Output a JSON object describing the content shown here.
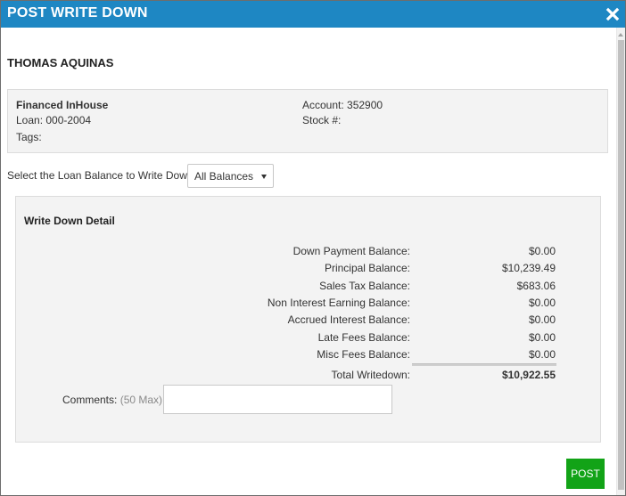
{
  "dialog": {
    "title": "POST WRITE DOWN",
    "close_icon": "close-x-icon"
  },
  "customer": {
    "name": "THOMAS AQUINAS"
  },
  "info": {
    "financing": "Financed InHouse",
    "loan": "Loan: 000-2004",
    "tags": "Tags:",
    "account": "Account: 352900",
    "stock": "Stock #:"
  },
  "balance_select": {
    "label": "Select the Loan Balance to Write Down:",
    "selected": "All Balances"
  },
  "detail": {
    "title": "Write Down Detail",
    "rows": [
      {
        "label": "Down Payment Balance:",
        "amount": "$0.00"
      },
      {
        "label": "Principal Balance:",
        "amount": "$10,239.49"
      },
      {
        "label": "Sales Tax Balance:",
        "amount": "$683.06"
      },
      {
        "label": "Non Interest Earning Balance:",
        "amount": "$0.00"
      },
      {
        "label": "Accrued Interest Balance:",
        "amount": "$0.00"
      },
      {
        "label": "Late Fees Balance:",
        "amount": "$0.00"
      },
      {
        "label": "Misc Fees Balance:",
        "amount": "$0.00"
      }
    ],
    "total_label": "Total Writedown:",
    "total_amount": "$10,922.55"
  },
  "comments": {
    "label": "Comments:",
    "max": "(50 Max)",
    "value": ""
  },
  "actions": {
    "post_label": "POST"
  },
  "colors": {
    "titlebar": "#1e87c3",
    "post_button": "#12a317",
    "panel": "#f3f3f3"
  }
}
